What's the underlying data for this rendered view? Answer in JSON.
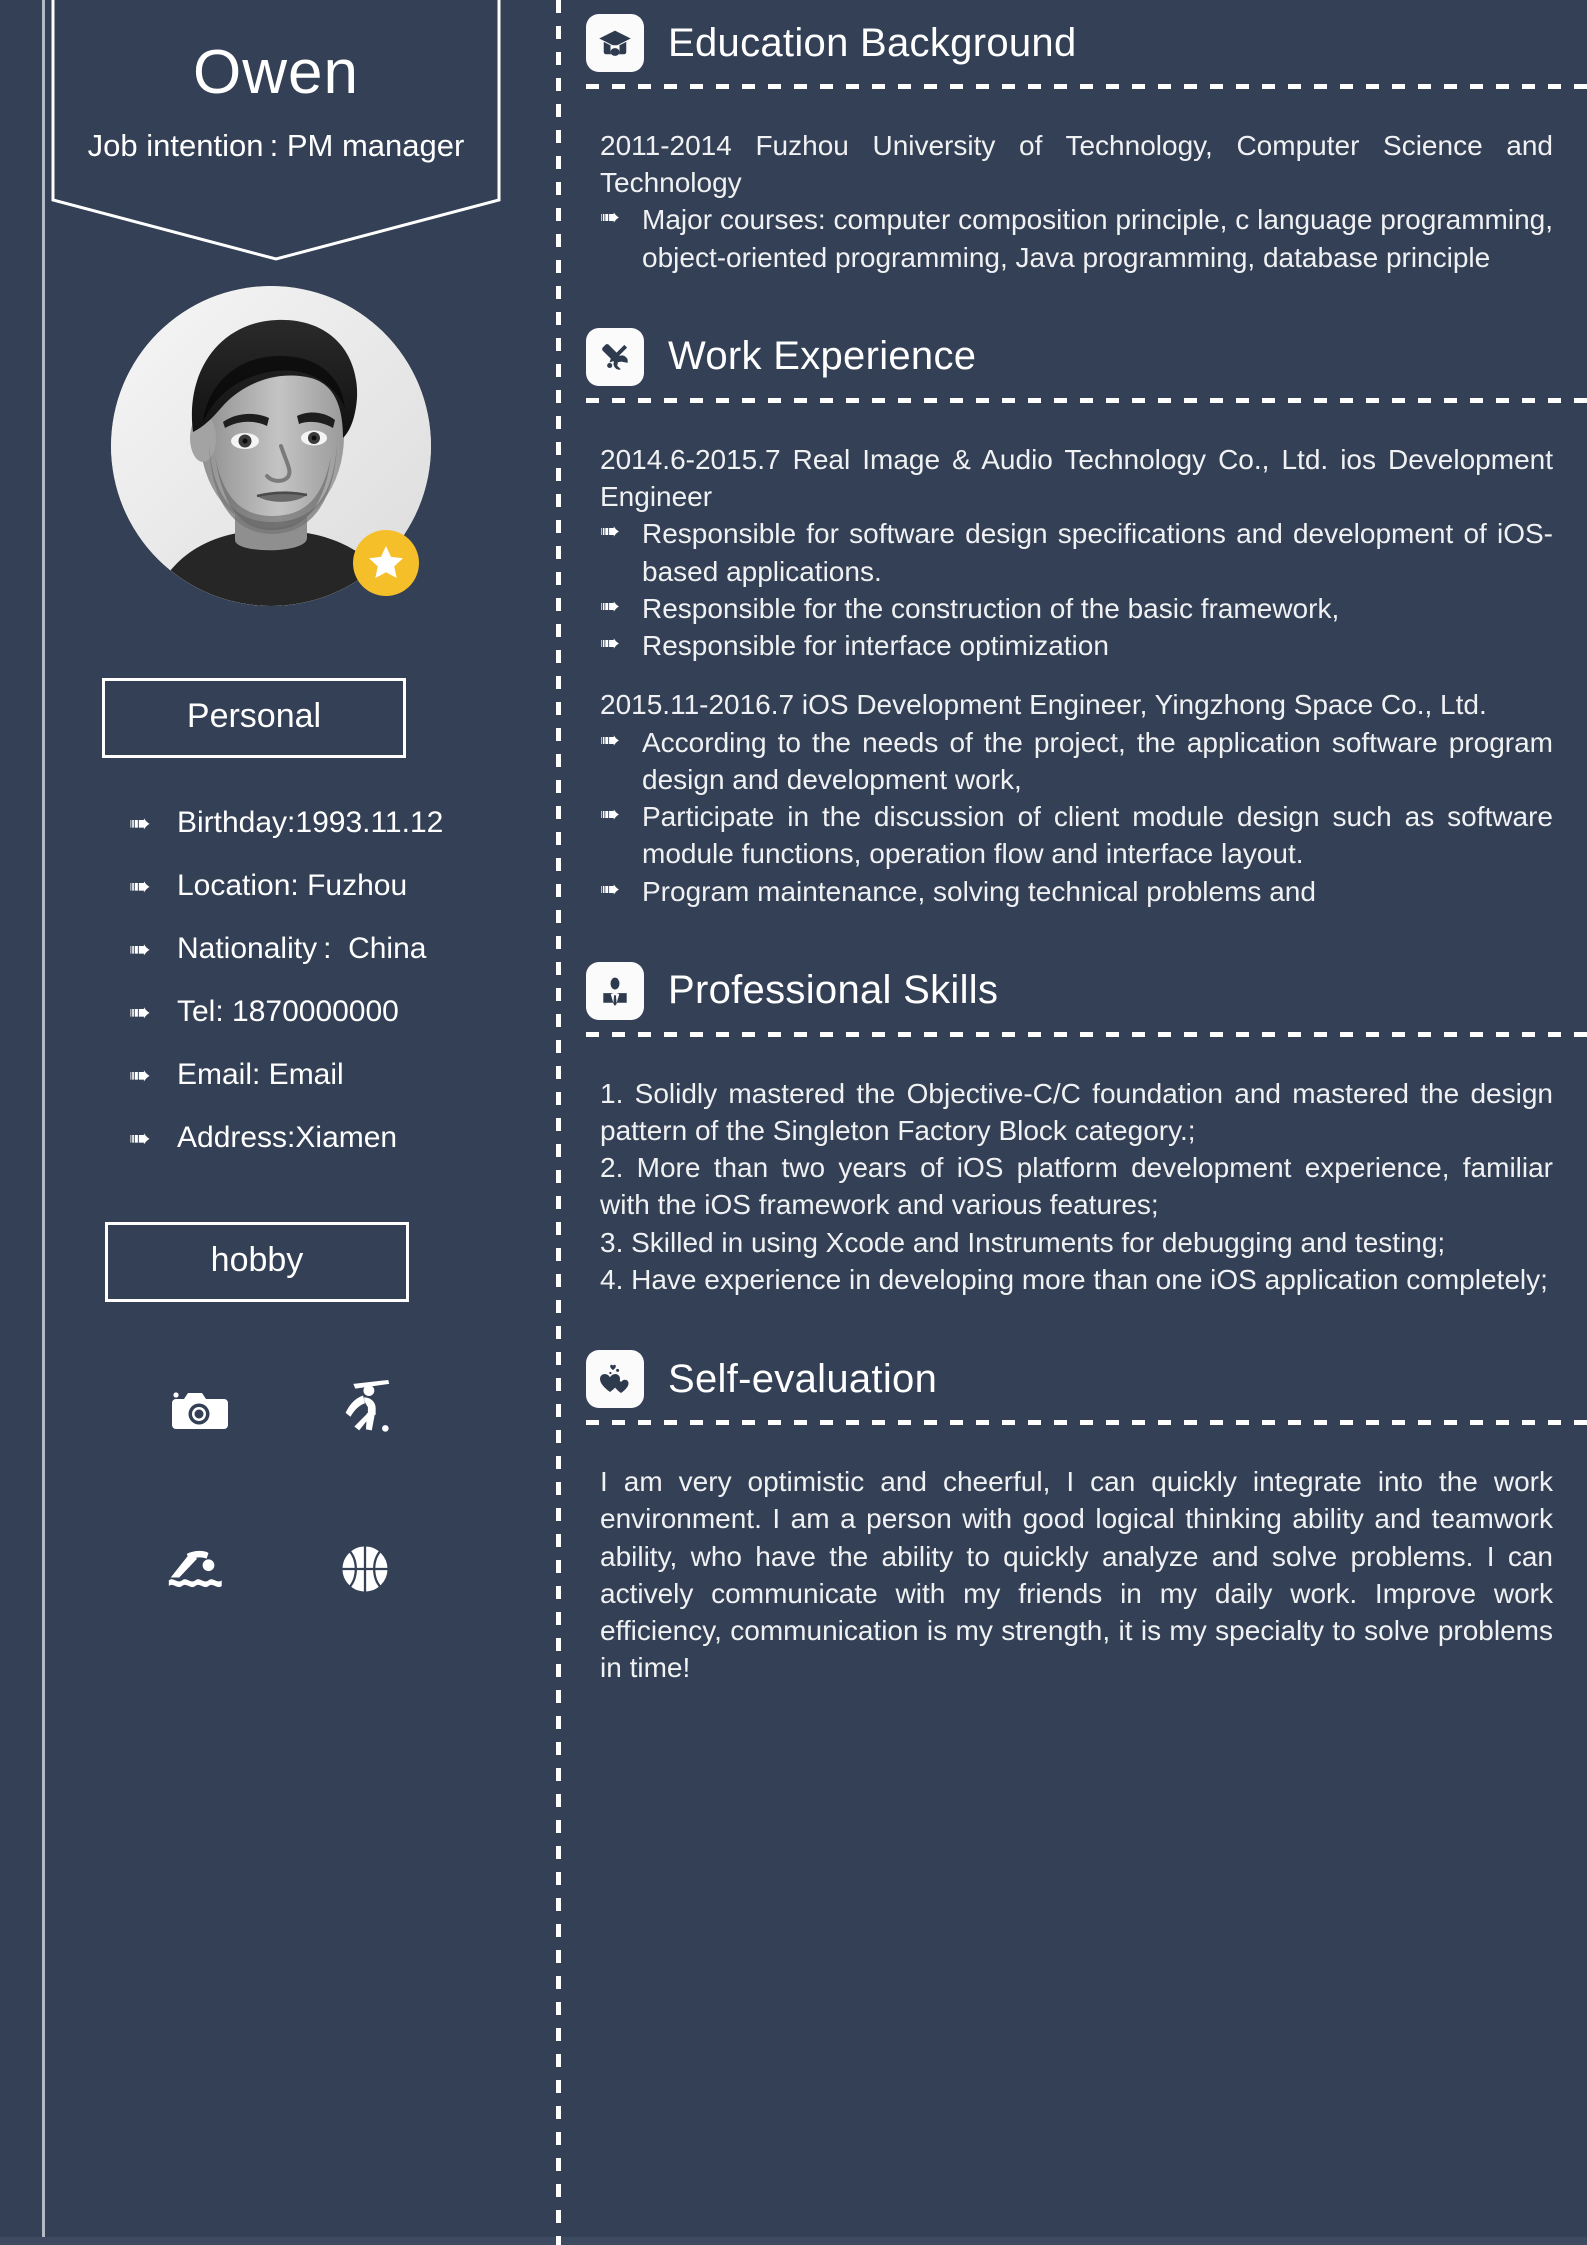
{
  "theme": {
    "background": "#344055",
    "text": "#ffffff",
    "icon_tile": "#fbfbfb",
    "star_badge": "#f5bf2a"
  },
  "sidebar": {
    "banner": {
      "name": "Owen",
      "job_intention": "Job intention : PM manager"
    },
    "avatar": {
      "name": "profile-photo",
      "badge_icon": "star-icon"
    },
    "personal": {
      "box_label": "Personal",
      "items": [
        {
          "icon": "arrow-bullet-icon",
          "text": "Birthday:1993.11.12"
        },
        {
          "icon": "arrow-bullet-icon",
          "text": "Location: Fuzhou"
        },
        {
          "icon": "arrow-bullet-icon",
          "text": "Nationality :  China"
        },
        {
          "icon": "arrow-bullet-icon",
          "text": "Tel: 1870000000"
        },
        {
          "icon": "arrow-bullet-icon",
          "text": "Email: Email"
        },
        {
          "icon": "arrow-bullet-icon",
          "text": "Address:Xiamen"
        }
      ]
    },
    "hobby": {
      "box_label": "hobby",
      "icons": [
        {
          "name": "camera-icon",
          "label": "Photography"
        },
        {
          "name": "golf-swing-icon",
          "label": "Golf"
        },
        {
          "name": "swimming-icon",
          "label": "Swimming"
        },
        {
          "name": "basketball-icon",
          "label": "Basketball"
        }
      ]
    }
  },
  "main": {
    "sections": [
      {
        "id": "education",
        "icon": "graduation-cap-icon",
        "title": "Education Background",
        "intro": "2011-2014 Fuzhou University of Technology, Computer Science and Technology",
        "bullets": [
          "Major courses: computer composition principle, c language programming, object-oriented programming, Java programming, database principle"
        ]
      },
      {
        "id": "work-experience",
        "icon": "tools-icon",
        "title": "Work Experience",
        "jobs": [
          {
            "header": "2014.6-2015.7 Real Image & Audio Technology Co., Ltd. ios Development Engineer",
            "bullets": [
              "Responsible for software design specifications and development of iOS-based applications.",
              "Responsible for the construction of the basic framework,",
              "Responsible for interface optimization"
            ]
          },
          {
            "header": "2015.11-2016.7 iOS Development Engineer, Yingzhong Space Co., Ltd.",
            "bullets": [
              "According to the needs of the project, the application software program design and development work,",
              "Participate in the discussion of client module design such as software module functions, operation flow and interface layout.",
              "Program maintenance, solving technical problems and"
            ]
          }
        ]
      },
      {
        "id": "professional-skills",
        "icon": "businessman-icon",
        "title": "Professional Skills",
        "lines": [
          "1. Solidly mastered the Objective-C/C foundation and mastered the design pattern of the Singleton Factory Block category.;",
          "2. More than two years of iOS platform development experience, familiar with the iOS framework and various features;",
          "3. Skilled in using Xcode and Instruments for debugging and testing;",
          "4. Have experience in developing more than one iOS application completely;"
        ]
      },
      {
        "id": "self-evaluation",
        "icon": "hearts-icon",
        "title": "Self-evaluation",
        "paragraph": "I am very optimistic and cheerful, I can quickly integrate into the work environment. I am a person with good logical thinking ability and teamwork ability, who have the ability to quickly analyze and solve problems. I can actively communicate with my friends in my daily work. Improve work efficiency, communication is my strength, it is my specialty to solve problems in time!"
      }
    ]
  }
}
